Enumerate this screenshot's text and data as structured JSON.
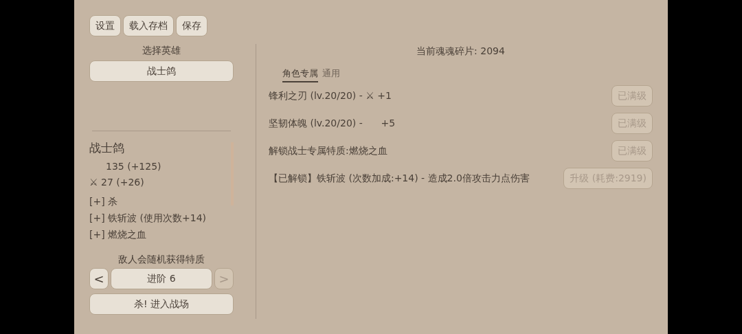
{
  "toolbar": [
    {
      "label": "设置",
      "disabled": false
    },
    {
      "label": "载入存档",
      "disabled": false
    },
    {
      "label": "保存",
      "disabled": false
    }
  ],
  "hero_select": {
    "title": "选择英雄",
    "value": "战士鸽"
  },
  "hero": {
    "name": "战士鸽",
    "stats": [
      "135 (+125)",
      "⚔ 27 (+26)"
    ],
    "traits": [
      "[+] 杀",
      "[+] 铁斩波 (使用次数+14)",
      "[+] 燃烧之血"
    ]
  },
  "difficulty": {
    "note": "敌人会随机获得特质",
    "prev": {
      "label": "<",
      "disabled": false
    },
    "value": "进阶 6",
    "next": {
      "label": ">",
      "disabled": true
    }
  },
  "start_button": "杀! 进入战场",
  "currency": "当前魂魂碎片: 2094",
  "tabs": [
    {
      "label": "角色专属",
      "selected": true
    },
    {
      "label": "通用",
      "selected": false
    }
  ],
  "upgrades": [
    {
      "text": "锋利之刃 (lv.20/20) - ⚔ +1",
      "button": {
        "label": "已满级",
        "disabled": true
      }
    },
    {
      "text": "坚韧体魄 (lv.20/20) -      +5",
      "button": {
        "label": "已满级",
        "disabled": true
      }
    },
    {
      "text": "解锁战士专属特质:燃烧之血",
      "button": {
        "label": "已满级",
        "disabled": true
      }
    },
    {
      "text": "【已解锁】铁斩波 (次数加成:+14) - 造成2.0倍攻击力点伤害",
      "button": {
        "label": "升级 (耗费:2919)",
        "disabled": true
      }
    }
  ]
}
